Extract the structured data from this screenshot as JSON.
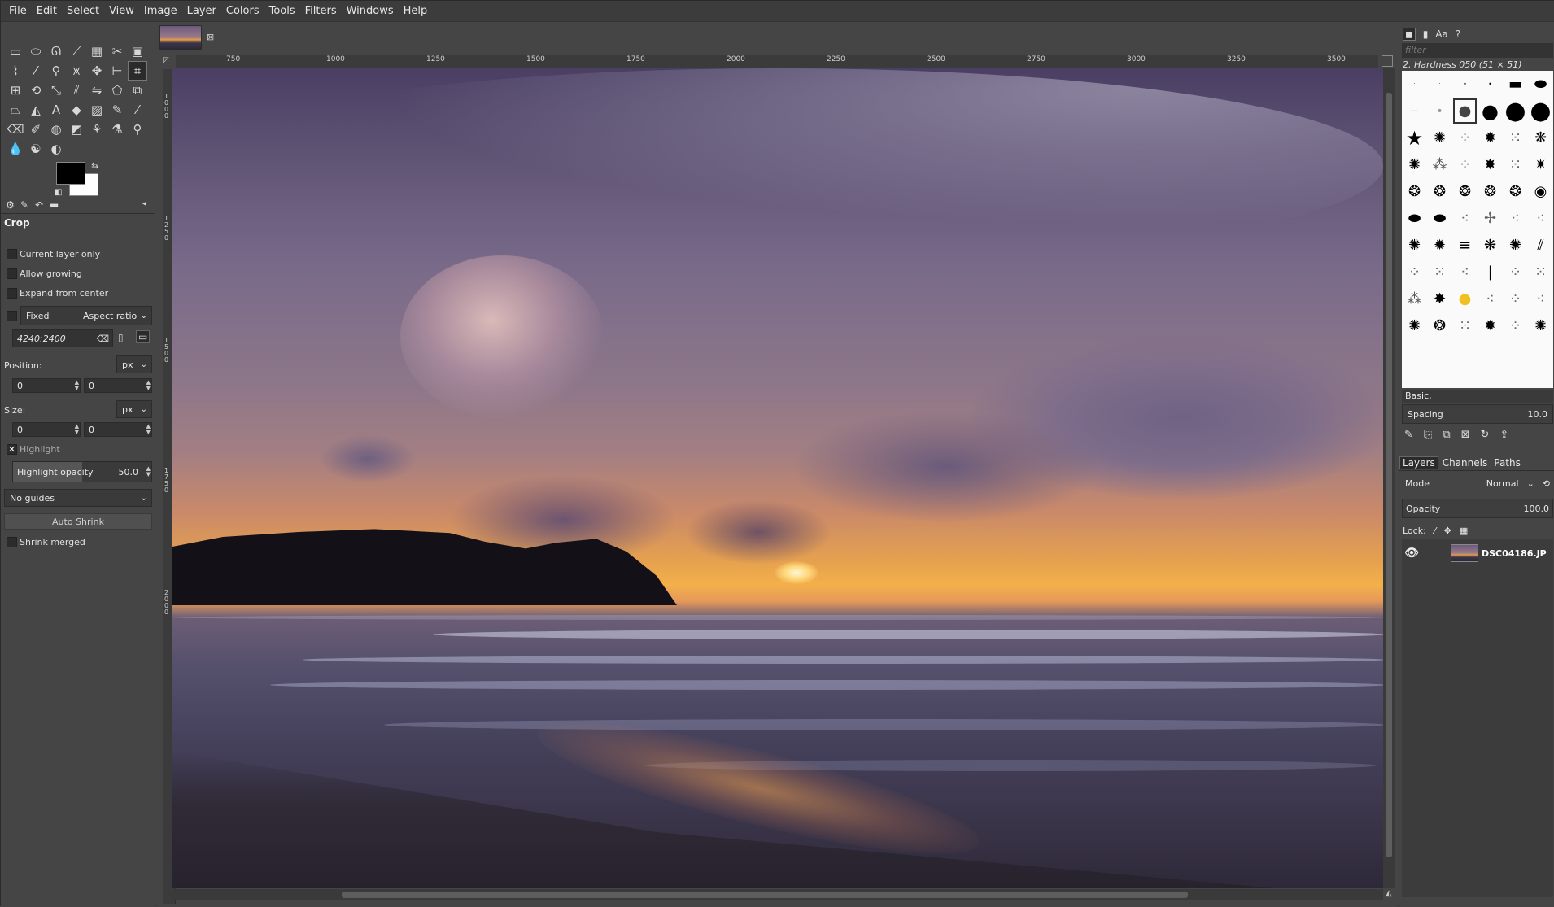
{
  "menubar": {
    "items": [
      "File",
      "Edit",
      "Select",
      "View",
      "Image",
      "Layer",
      "Colors",
      "Tools",
      "Filters",
      "Windows",
      "Help"
    ]
  },
  "toolbox": {
    "icons": [
      "rect-select-icon",
      "ellipse-select-icon",
      "free-select-icon",
      "fuzzy-select-icon",
      "select-by-color-icon",
      "scissors-icon",
      "foreground-select-icon",
      "paths-icon",
      "color-picker-icon",
      "zoom-icon",
      "measure-icon",
      "move-icon",
      "align-icon",
      "crop-icon",
      "unified-transform-icon",
      "rotate-icon",
      "scale-icon",
      "shear-icon",
      "flip-icon",
      "cage-icon",
      "warp-icon",
      "perspective-icon",
      "bucket-fill-icon",
      "text-icon",
      "gradient-icon",
      "pencil-icon",
      "paintbrush-icon",
      "ink-icon",
      "eraser-icon",
      "airbrush-icon",
      "clone-icon",
      "heal-icon",
      "smudge-icon",
      "dodge-icon",
      "mypaint-icon",
      "blur-icon",
      "smudge2-icon",
      "dodge-burn-icon"
    ],
    "active_tool": "crop-icon"
  },
  "tool_options": {
    "title": "Crop",
    "current_layer_only": "Current layer only",
    "allow_growing": "Allow growing",
    "expand_from_center": "Expand from center",
    "fixed_label": "Fixed",
    "fixed_mode": "Aspect ratio",
    "ratio_value": "4240:2400",
    "position_label": "Position:",
    "position_unit": "px",
    "position_x": "0",
    "position_y": "0",
    "size_label": "Size:",
    "size_unit": "px",
    "size_w": "0",
    "size_h": "0",
    "highlight_label": "Highlight",
    "highlight_opacity_label": "Highlight opacity",
    "highlight_opacity_value": "50.0",
    "guides": "No guides",
    "auto_shrink": "Auto Shrink",
    "shrink_merged": "Shrink merged"
  },
  "ruler": {
    "top_labels": [
      "750",
      "1000",
      "1250",
      "1500",
      "1750",
      "2000",
      "2250",
      "2500",
      "2750",
      "3000",
      "3250",
      "3500"
    ],
    "left_labels": [
      "1000",
      "1250",
      "1500",
      "1750",
      "2000"
    ]
  },
  "brushes": {
    "filter_placeholder": "filter",
    "current": "2. Hardness 050 (51 × 51)",
    "preset": "Basic,",
    "spacing_label": "Spacing",
    "spacing_value": "10.0"
  },
  "layers": {
    "tabs": [
      "Layers",
      "Channels",
      "Paths"
    ],
    "mode_label": "Mode",
    "mode_value": "Normal",
    "opacity_label": "Opacity",
    "opacity_value": "100.0",
    "lock_label": "Lock:",
    "layer_name": "DSC04186.JP"
  }
}
